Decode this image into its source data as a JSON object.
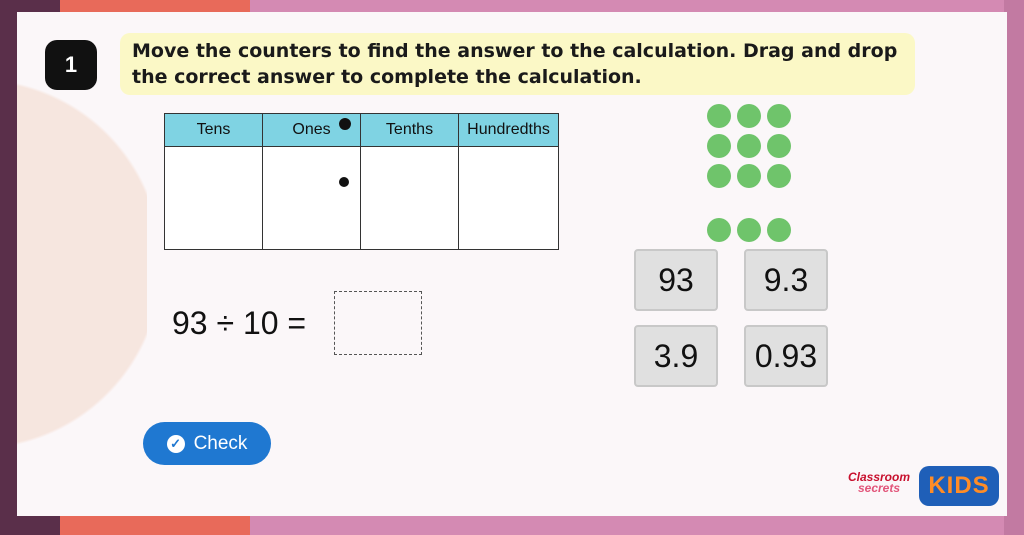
{
  "question": {
    "number": "1",
    "instruction": "Move the counters to find the answer to the calculation. Drag and drop the correct answer to complete the calculation."
  },
  "place_value_table": {
    "headers": [
      "Tens",
      "Ones",
      "Tenths",
      "Hundredths"
    ]
  },
  "counters": {
    "color": "#6fc46b"
  },
  "equation": {
    "text": "93 ÷ 10 ="
  },
  "options": [
    "93",
    "9.3",
    "3.9",
    "0.93"
  ],
  "check_button": {
    "label": "Check",
    "icon": "check-circle-icon"
  },
  "logo": {
    "line1": "Classroom",
    "line2": "secrets",
    "kids": "KIDS"
  },
  "colors": {
    "header_bg": "#7fd3e3",
    "instruction_bg": "#fbf8c6",
    "check_bg": "#1f78d1"
  }
}
